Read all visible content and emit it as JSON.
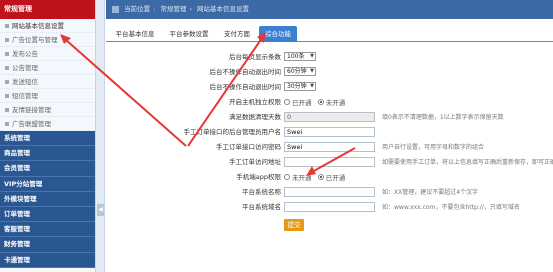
{
  "sidebar": {
    "header": "常规管理",
    "items": [
      {
        "label": "网站基本信息设置",
        "active": true
      },
      {
        "label": "广告位置与管理"
      },
      {
        "label": "发布公告"
      },
      {
        "label": "公告管理"
      },
      {
        "label": "发送短信"
      },
      {
        "label": "短信管理"
      },
      {
        "label": "友情链接管理"
      },
      {
        "label": "广告联盟管理"
      }
    ],
    "groups": [
      "系统管理",
      "商品管理",
      "会员管理",
      "VIP分站管理",
      "外模块管理",
      "订单管理",
      "客服管理",
      "财务管理",
      "卡通管理"
    ]
  },
  "topbar": {
    "crumbs": [
      "当前位置",
      "常规管理",
      "网站基本信息设置"
    ]
  },
  "tabs": [
    {
      "label": "平台基本信息"
    },
    {
      "label": "平台参数设置"
    },
    {
      "label": "支付方面"
    },
    {
      "label": "综合功能",
      "active": true
    }
  ],
  "form": {
    "rows": [
      {
        "label": "后台每页显示条数",
        "select": "100条"
      },
      {
        "label": "后台不操作自动退出时间",
        "select": "60分钟"
      },
      {
        "label": "后台不操作自动退出时间",
        "select": "30分钟"
      },
      {
        "label": "开启主机独立权限",
        "radio": [
          "已开通",
          "未开通"
        ],
        "selected": 1
      },
      {
        "label": "满足数据清理天数",
        "input": "0",
        "disabled": true,
        "hint": "填0表示不清理数据，1以上数字表示保留天数"
      },
      {
        "label": "手工订单接口的后台管理员用户名",
        "input": "Swei"
      },
      {
        "label": "手工订单接口访问密码",
        "input": "Swei",
        "hint": "用户自行设置，可用字母和数字的组合"
      },
      {
        "label": "手工订单访问地址",
        "input": "",
        "hint": "如需要使用手工订单，将以上信息填写正确后重新保存，即可正确访问"
      },
      {
        "label": "手机端app权限",
        "radio": [
          "未开通",
          "已开通"
        ],
        "selected": 1
      },
      {
        "label": "平台系统名称",
        "input": "",
        "hint": "如：XX管理，建议不要超过4个汉字"
      },
      {
        "label": "平台系统域名",
        "input": "",
        "hint": "如：www.xxx.com，不要包含http://，只填写域名"
      }
    ],
    "submit_label": "提交"
  },
  "colors": {
    "sidebar_header": "#c0121b",
    "group_bg": "#2a5792",
    "topbar_bg": "#3b6aa6",
    "active_tab": "#3b7fd1",
    "submit_bg": "#e49a17",
    "annotation_arrow": "#e53935"
  }
}
